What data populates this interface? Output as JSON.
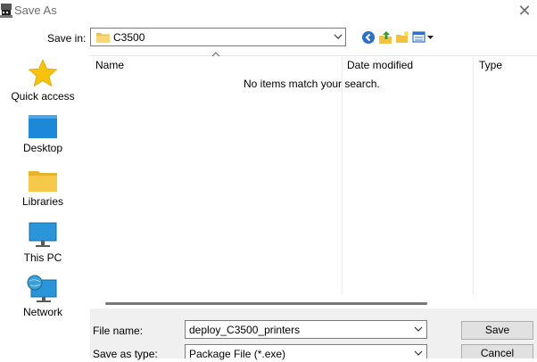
{
  "window": {
    "title": "Save As",
    "close_glyph": "✕"
  },
  "toolbar": {
    "save_in_label": "Save in:",
    "location_value": "C3500",
    "icons": [
      "back-icon",
      "up-folder-icon",
      "new-folder-icon",
      "view-menu-icon"
    ]
  },
  "sidebar": {
    "items": [
      {
        "label": "Quick access",
        "icon": "star-icon"
      },
      {
        "label": "Desktop",
        "icon": "desktop-icon"
      },
      {
        "label": "Libraries",
        "icon": "libraries-icon"
      },
      {
        "label": "This PC",
        "icon": "computer-icon"
      },
      {
        "label": "Network",
        "icon": "network-icon"
      }
    ]
  },
  "file_list": {
    "columns": [
      "Name",
      "Date modified",
      "Type"
    ],
    "empty_message": "No items match your search."
  },
  "form": {
    "file_name_label": "File name:",
    "file_name_value": "deploy_C3500_printers",
    "save_as_type_label": "Save as type:",
    "save_as_type_value": "Package File (*.exe)"
  },
  "buttons": {
    "save": "Save",
    "cancel": "Cancel"
  },
  "colors": {
    "accent_blue": "#1e73c8",
    "folder_yellow": "#f2c343",
    "star_yellow": "#f6c20e"
  }
}
